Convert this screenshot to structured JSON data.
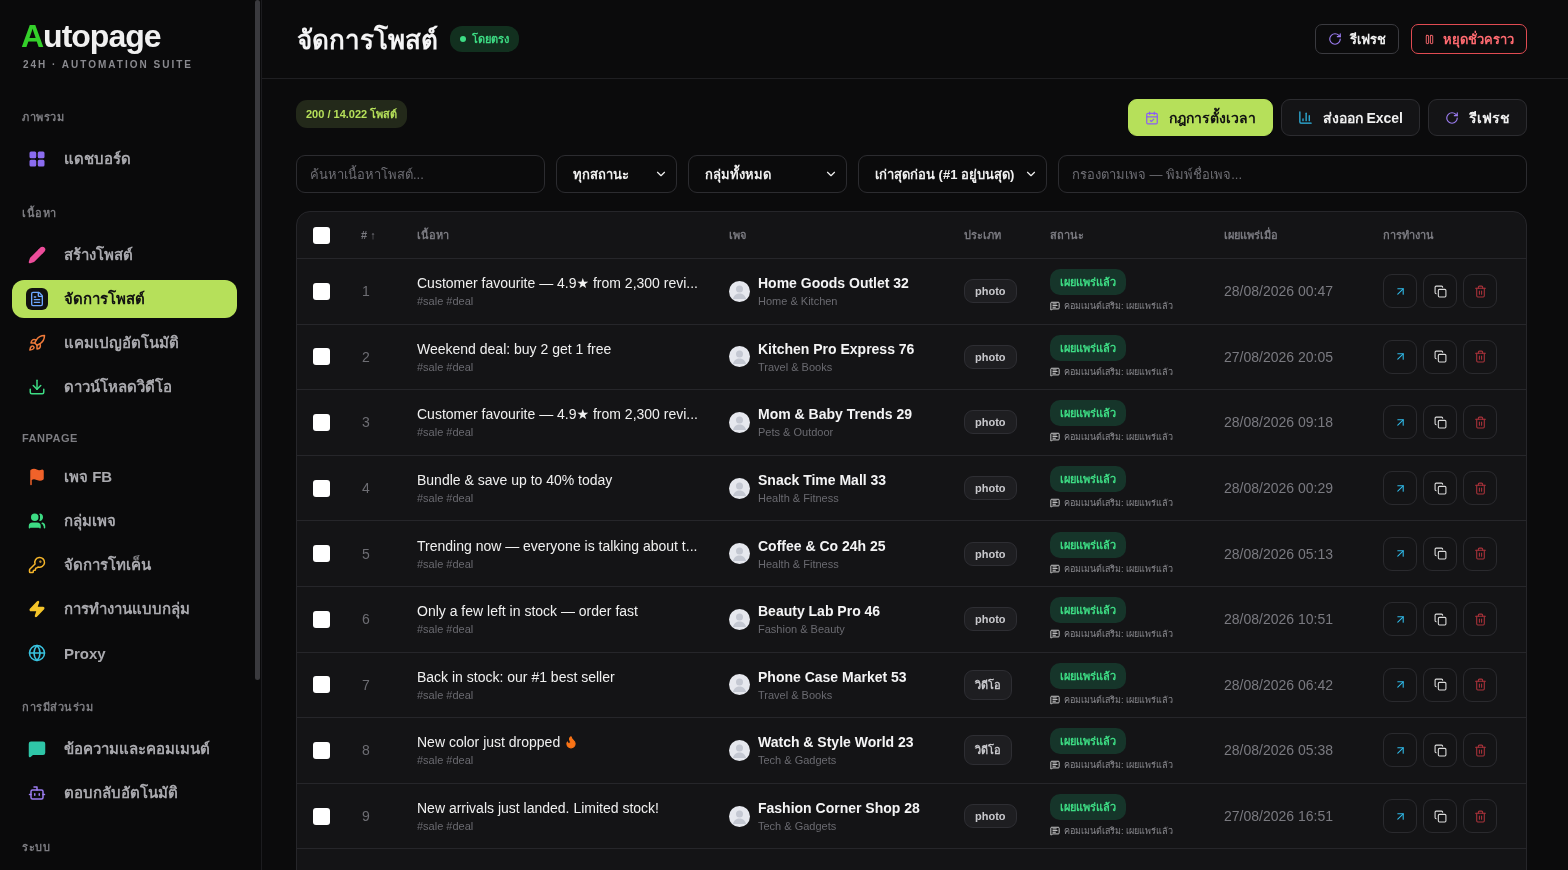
{
  "sidebar": {
    "logo": "Autopage",
    "tagline": "24H · AUTOMATION SUITE",
    "sections": [
      {
        "label": "ภาพรวม",
        "items": [
          {
            "label": "แดชบอร์ด",
            "selected": false
          }
        ]
      },
      {
        "label": "เนื้อหา",
        "items": [
          {
            "label": "สร้างโพสต์",
            "selected": false
          },
          {
            "label": "จัดการโพสต์",
            "selected": true
          },
          {
            "label": "แคมเปญอัตโนมัติ",
            "selected": false
          },
          {
            "label": "ดาวน์โหลดวิดีโอ",
            "selected": false
          }
        ]
      },
      {
        "label": "FANPAGE",
        "items": [
          {
            "label": "เพจ FB",
            "selected": false
          },
          {
            "label": "กลุ่มเพจ",
            "selected": false
          },
          {
            "label": "จัดการโทเค็น",
            "selected": false
          },
          {
            "label": "การทำงานแบบกลุ่ม",
            "selected": false
          },
          {
            "label": "Proxy",
            "selected": false
          }
        ]
      },
      {
        "label": "การมีส่วนร่วม",
        "items": [
          {
            "label": "ข้อความและคอมเมนต์",
            "selected": false
          },
          {
            "label": "ตอบกลับอัตโนมัติ",
            "selected": false
          }
        ]
      },
      {
        "label": "ระบบ"
      }
    ]
  },
  "header": {
    "title": "จัดการโพสต์",
    "badge": "โดยตรง",
    "buttons": [
      {
        "label": "รีเฟรช",
        "kind": "refresh"
      },
      {
        "label": "หยุดชั่วคราว",
        "kind": "pause"
      }
    ]
  },
  "toolbar": {
    "count": "200 / 14.022 โพสต์",
    "buttons": [
      {
        "label": "กฎการตั้งเวลา",
        "kind": "schedule"
      },
      {
        "label": "ส่งออก Excel",
        "kind": "export"
      },
      {
        "label": "รีเฟรช",
        "kind": "refresh"
      }
    ]
  },
  "filters": {
    "search": {
      "placeholder": "ค้นหาเนื้อหาโพสต์..."
    },
    "selects": [
      "ทุกสถานะ",
      "กลุ่มทั้งหมด",
      "เก่าสุดก่อน (#1 อยู่บนสุด)"
    ],
    "page_filter": {
      "placeholder": "กรองตามเพจ — พิมพ์ชื่อเพจ..."
    }
  },
  "table": {
    "select_all": {
      "checked": false
    },
    "columns": [
      "#",
      "เนื้อหา",
      "เพจ",
      "ประเภท",
      "สถานะ",
      "เผยแพร่เมื่อ",
      "การทำงาน"
    ],
    "sort_indicator": "↑",
    "rows": [
      {
        "checked": false,
        "index": "1",
        "content": "Customer favourite — 4.9★ from 2,300 revi...",
        "tags": "#sale #deal",
        "page": "Home Goods Outlet 32",
        "category": "Home & Kitchen",
        "type": "photo",
        "status": "เผยแพร่แล้ว",
        "note": "คอมเมนต์เสริม: เผยแพร่แล้ว",
        "date": "28/08/2026 00:47"
      },
      {
        "checked": false,
        "index": "2",
        "content": "Weekend deal: buy 2 get 1 free",
        "tags": "#sale #deal",
        "page": "Kitchen Pro Express 76",
        "category": "Travel & Books",
        "type": "photo",
        "status": "เผยแพร่แล้ว",
        "note": "คอมเมนต์เสริม: เผยแพร่แล้ว",
        "date": "27/08/2026 20:05"
      },
      {
        "checked": false,
        "index": "3",
        "content": "Customer favourite — 4.9★ from 2,300 revi...",
        "tags": "#sale #deal",
        "page": "Mom & Baby Trends 29",
        "category": "Pets & Outdoor",
        "type": "photo",
        "status": "เผยแพร่แล้ว",
        "note": "คอมเมนต์เสริม: เผยแพร่แล้ว",
        "date": "28/08/2026 09:18"
      },
      {
        "checked": false,
        "index": "4",
        "content": "Bundle & save up to 40% today",
        "tags": "#sale #deal",
        "page": "Snack Time Mall 33",
        "category": "Health & Fitness",
        "type": "photo",
        "status": "เผยแพร่แล้ว",
        "note": "คอมเมนต์เสริม: เผยแพร่แล้ว",
        "date": "28/08/2026 00:29"
      },
      {
        "checked": false,
        "index": "5",
        "content": "Trending now — everyone is talking about t...",
        "tags": "#sale #deal",
        "page": "Coffee & Co 24h 25",
        "category": "Health & Fitness",
        "type": "photo",
        "status": "เผยแพร่แล้ว",
        "note": "คอมเมนต์เสริม: เผยแพร่แล้ว",
        "date": "28/08/2026 05:13"
      },
      {
        "checked": false,
        "index": "6",
        "content": "Only a few left in stock — order fast",
        "tags": "#sale #deal",
        "page": "Beauty Lab Pro 46",
        "category": "Fashion & Beauty",
        "type": "photo",
        "status": "เผยแพร่แล้ว",
        "note": "คอมเมนต์เสริม: เผยแพร่แล้ว",
        "date": "28/08/2026 10:51"
      },
      {
        "checked": false,
        "index": "7",
        "content": "Back in stock: our #1 best seller",
        "tags": "#sale #deal",
        "page": "Phone Case Market 53",
        "category": "Travel & Books",
        "type": "วิดีโอ",
        "status": "เผยแพร่แล้ว",
        "note": "คอมเมนต์เสริม: เผยแพร่แล้ว",
        "date": "28/08/2026 06:42"
      },
      {
        "checked": false,
        "index": "8",
        "content": "New color just dropped",
        "flame": true,
        "tags": "#sale #deal",
        "page": "Watch & Style World 23",
        "category": "Tech & Gadgets",
        "type": "วิดีโอ",
        "status": "เผยแพร่แล้ว",
        "note": "คอมเมนต์เสริม: เผยแพร่แล้ว",
        "date": "28/08/2026 05:38"
      },
      {
        "checked": false,
        "index": "9",
        "content": "New arrivals just landed. Limited stock!",
        "tags": "#sale #deal",
        "page": "Fashion Corner Shop 28",
        "category": "Tech & Gadgets",
        "type": "photo",
        "status": "เผยแพร่แล้ว",
        "note": "คอมเมนต์เสริม: เผยแพร่แล้ว",
        "date": "27/08/2026 16:51"
      }
    ]
  }
}
